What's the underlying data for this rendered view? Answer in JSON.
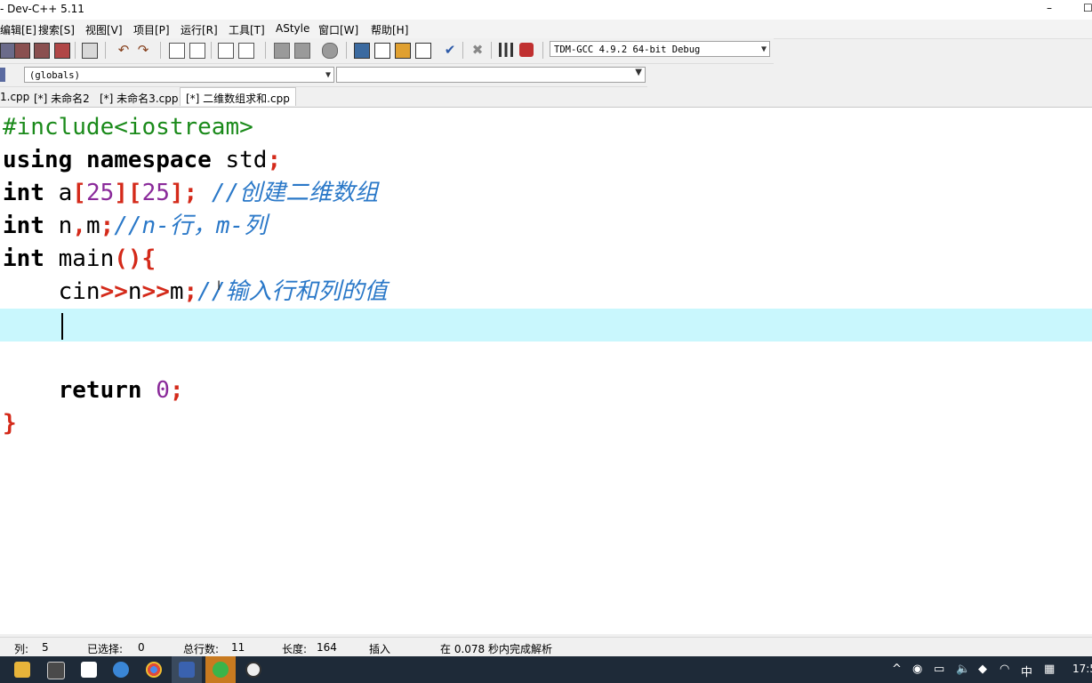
{
  "window": {
    "title": "- Dev-C++ 5.11",
    "minimize": "–",
    "maximize": "☐"
  },
  "menu": [
    "编辑[E]",
    "搜索[S]",
    "视图[V]",
    "项目[P]",
    "运行[R]",
    "工具[T]",
    "AStyle",
    "窗口[W]",
    "帮助[H]"
  ],
  "toolbar": {
    "compiler": "TDM-GCC 4.9.2 64-bit Debug"
  },
  "classbar": {
    "scope": "(globals)",
    "member": ""
  },
  "tabs": [
    {
      "label": "1.cpp",
      "active": false
    },
    {
      "label": "[*] 未命名2",
      "active": false
    },
    {
      "label": "[*] 未命名3.cpp",
      "active": false
    },
    {
      "label": "[*] 二维数组求和.cpp",
      "active": true
    }
  ],
  "code": {
    "l1_pp": "#include<iostream>",
    "l2_using": "using",
    "l2_namespace": "namespace",
    "l2_std": " std",
    "l2_semi": ";",
    "l3_int": "int",
    "l3_a": " a",
    "l3_b1": "[",
    "l3_n1": "25",
    "l3_b2": "][",
    "l3_n2": "25",
    "l3_b3": "];",
    "l3_comment": " //创建二维数组",
    "l4_int": "int",
    "l4_n": " n",
    "l4_comma": ",",
    "l4_m": "m",
    "l4_semi": ";",
    "l4_comment": "//n-行，m-列",
    "l5_int": "int",
    "l5_main": " main",
    "l5_sym": "(){",
    "l6_cin": "    cin",
    "l6_op1": ">>",
    "l6_n": "n",
    "l6_op2": ">>",
    "l6_m": "m",
    "l6_semi": ";",
    "l6_comment": "//输入行和列的值",
    "l9_return": "    return",
    "l9_zero": "0",
    "l9_semi": ";",
    "l10_close": "}"
  },
  "status": {
    "col_label": "列:",
    "col_value": "5",
    "sel_label": "已选择:",
    "sel_value": "0",
    "lines_label": "总行数:",
    "lines_value": "11",
    "len_label": "长度:",
    "len_value": "164",
    "mode": "插入",
    "parse_msg": "在 0.078 秒内完成解析"
  },
  "taskbar": {
    "ime": "中",
    "clock": "17:5"
  }
}
